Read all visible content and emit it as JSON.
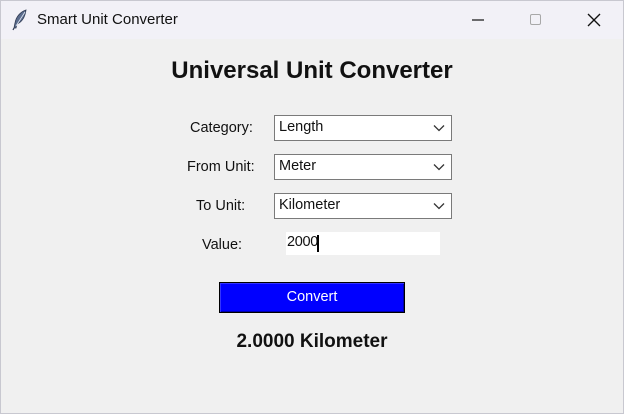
{
  "window": {
    "title": "Smart Unit Converter",
    "icon": "feather-icon",
    "controls": [
      "minimize-icon",
      "maximize-icon",
      "close-icon"
    ]
  },
  "main": {
    "heading": "Universal Unit Converter",
    "category": {
      "label": "Category:",
      "value": "Length"
    },
    "from_unit": {
      "label": "From Unit:",
      "value": "Meter"
    },
    "to_unit": {
      "label": "To Unit:",
      "value": "Kilometer"
    },
    "value": {
      "label": "Value:",
      "input": "2000"
    },
    "convert_label": "Convert",
    "result": "2.0000 Kilometer"
  },
  "colors": {
    "convert_button": "#0000ff",
    "convert_text": "#ffffff",
    "background": "#f0f0f0",
    "titlebar": "#f2f1f7"
  }
}
